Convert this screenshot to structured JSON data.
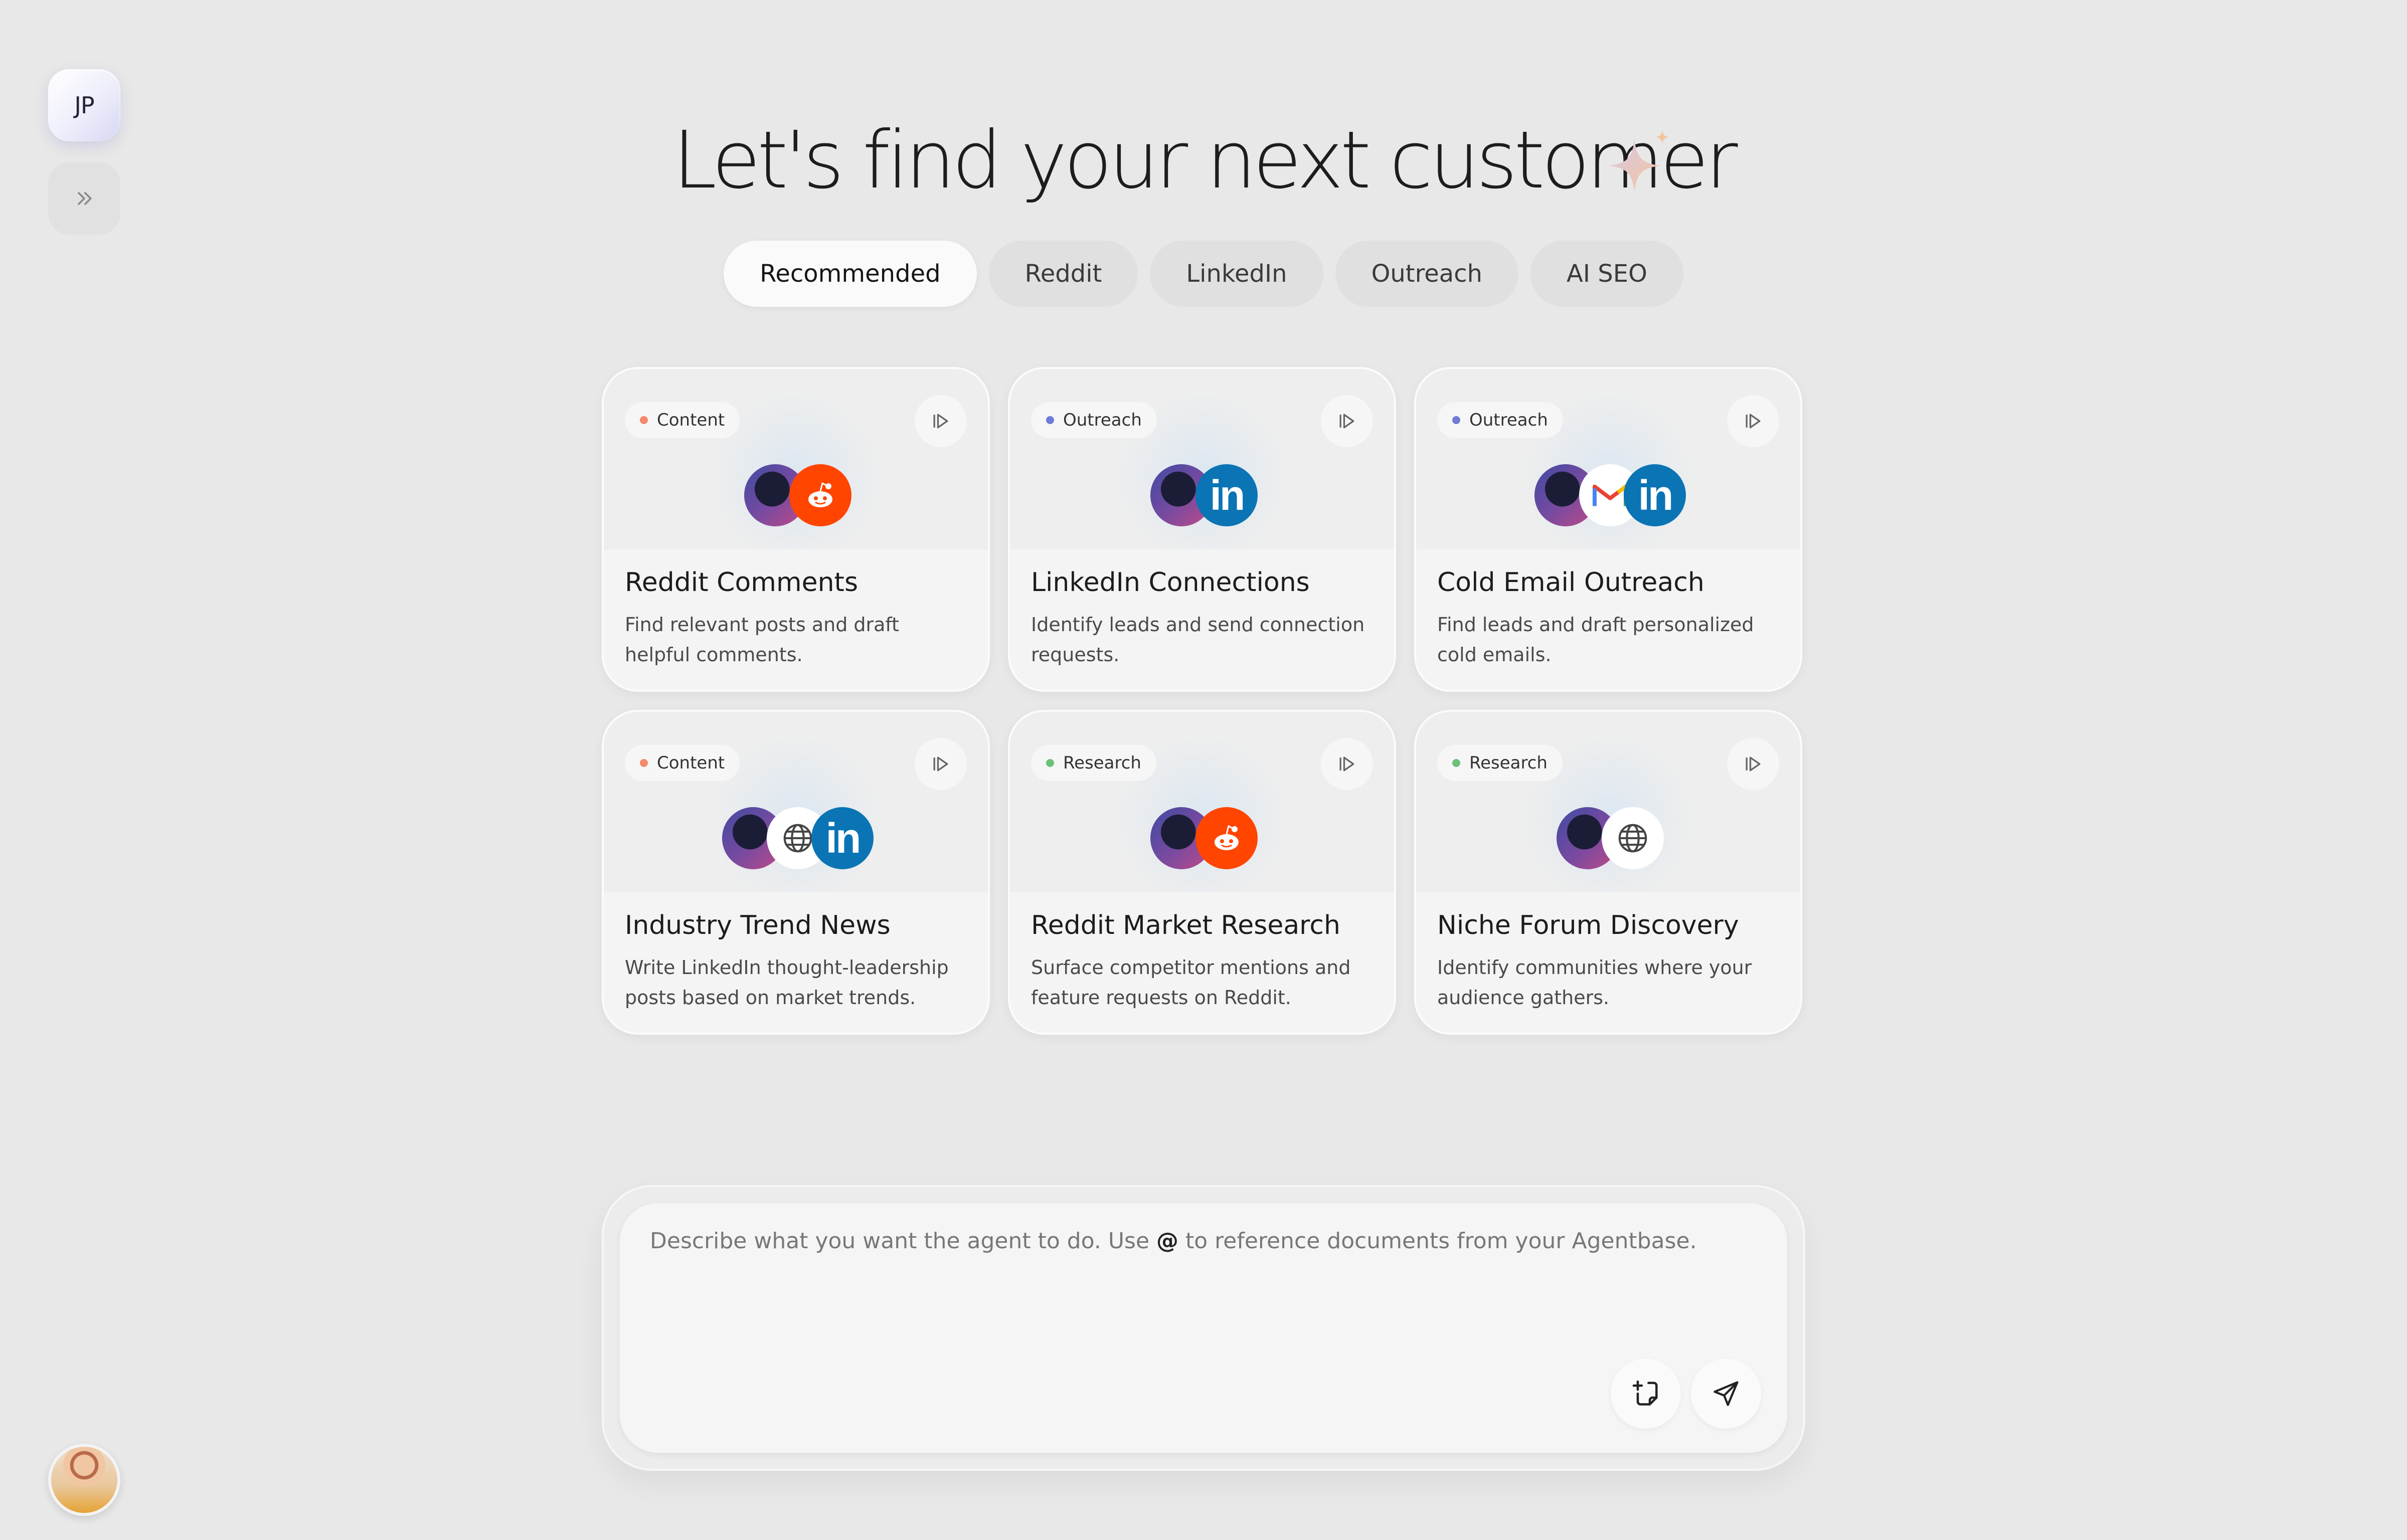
{
  "sidebar": {
    "workspace_initials": "JP",
    "expand_icon": "chevron-double-right-icon"
  },
  "header": {
    "title": "Let's find your next customer"
  },
  "tabs": [
    {
      "label": "Recommended",
      "active": true
    },
    {
      "label": "Reddit",
      "active": false
    },
    {
      "label": "LinkedIn",
      "active": false
    },
    {
      "label": "Outreach",
      "active": false
    },
    {
      "label": "AI SEO",
      "active": false
    }
  ],
  "colors": {
    "content_dot": "#f28a6b",
    "outreach_dot": "#6f7bd6",
    "research_dot": "#6cc07a"
  },
  "cards": [
    {
      "tag": "Content",
      "title": "Reddit Comments",
      "description": "Find relevant posts and draft helpful comments.",
      "icons": [
        "person-icon",
        "reddit-icon"
      ]
    },
    {
      "tag": "Outreach",
      "title": "LinkedIn Connections",
      "description": "Identify leads and send connection requests.",
      "icons": [
        "person-icon",
        "linkedin-icon"
      ]
    },
    {
      "tag": "Outreach",
      "title": "Cold Email Outreach",
      "description": "Find leads and draft personalized cold emails.",
      "icons": [
        "person-icon",
        "gmail-icon",
        "linkedin-icon"
      ]
    },
    {
      "tag": "Content",
      "title": "Industry Trend News",
      "description": "Write LinkedIn thought-leadership posts based on market trends.",
      "icons": [
        "person-icon",
        "globe-icon",
        "linkedin-icon"
      ]
    },
    {
      "tag": "Research",
      "title": "Reddit Market Research",
      "description": "Surface competitor mentions and feature requests on Reddit.",
      "icons": [
        "person-icon",
        "reddit-icon"
      ]
    },
    {
      "tag": "Research",
      "title": "Niche Forum Discovery",
      "description": "Identify communities where your audience gathers.",
      "icons": [
        "person-icon",
        "globe-icon"
      ]
    }
  ],
  "composer": {
    "placeholder_before": "Describe what you want the agent to do. Use ",
    "placeholder_at": "@",
    "placeholder_after": " to reference documents from your Agentbase."
  }
}
